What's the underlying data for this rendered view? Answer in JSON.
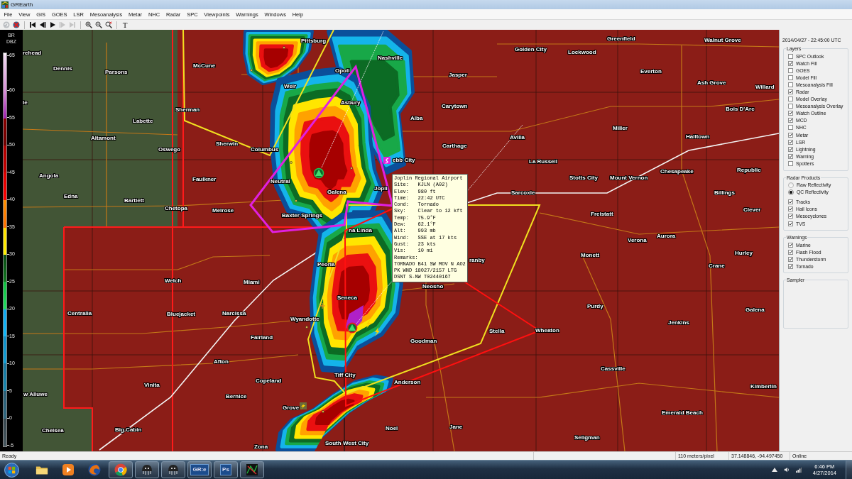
{
  "window": {
    "title": "GREarth"
  },
  "menu": [
    "File",
    "View",
    "GIS",
    "GOES",
    "LSR",
    "Mesoanalysis",
    "Metar",
    "NHC",
    "Radar",
    "SPC",
    "Viewpoints",
    "Warnings",
    "Windows",
    "Help"
  ],
  "toolbar": [
    {
      "kind": "refresh",
      "disabled": true
    },
    {
      "kind": "stop",
      "disabled": false
    },
    {
      "kind": "first",
      "disabled": false
    },
    {
      "kind": "back",
      "disabled": false
    },
    {
      "kind": "play",
      "disabled": false
    },
    {
      "kind": "forward",
      "disabled": true
    },
    {
      "kind": "last",
      "disabled": true
    },
    {
      "kind": "zoom_in",
      "disabled": false
    },
    {
      "kind": "zoom_out",
      "disabled": false
    },
    {
      "kind": "zoom_reset",
      "disabled": false
    },
    {
      "kind": "text",
      "label": "T",
      "disabled": false
    }
  ],
  "color_scale": {
    "title": [
      "BR",
      "DBZ"
    ],
    "ticks": [
      "65",
      "60",
      "55",
      "50",
      "45",
      "40",
      "35",
      "30",
      "25",
      "20",
      "15",
      "10",
      "5",
      "0",
      "-5"
    ]
  },
  "map": {
    "towns": [
      "Pittsburg",
      "Greenfield",
      "Walnut Grove",
      "rehead",
      "Nashville",
      "Golden City",
      "Lockwood",
      "Dennis",
      "Parsons",
      "McCune",
      "Opoli",
      "Jasper",
      "Everton",
      "Weir",
      "Ash Grove",
      "Willard",
      "le",
      "Sherman",
      "Asbury",
      "Carytown",
      "Bois D'Arc",
      "Labette",
      "Alba",
      "Miller",
      "Altamont",
      "Avilla",
      "Halltown",
      "Oswego",
      "Sherwin",
      "Columbus",
      "Carthage",
      "ebb City",
      "La Russell",
      "Angola",
      "Chesapeake",
      "Republic",
      "Faulkner",
      "Neutral",
      "Stotts City",
      "Mount Vernon",
      "Edna",
      "Galena",
      "Jopli",
      "Sarcoxie",
      "Billings",
      "Bartlett",
      "Chetopa",
      "Melrose",
      "Baxter Springs",
      "Freistatt",
      "Clever",
      "na Linda",
      "Verona",
      "Aurora",
      "Peoria",
      "ranby",
      "Monett",
      "Crane",
      "Hurley",
      "Welch",
      "Miami",
      "Neosho",
      "Seneca",
      "Centralia",
      "Bluejacket",
      "Narcissa",
      "Purdy",
      "Galena",
      "Wyandotte",
      "Jenkins",
      "Fairland",
      "Goodman",
      "Stella",
      "Wheaton",
      "Afton",
      "Vinita",
      "Copeland",
      "Tiff City",
      "Anderson",
      "Cassville",
      "Kimberlin",
      "w Alluwe",
      "Bernice",
      "Grove",
      "Emerald Beach",
      "Chelsea",
      "Big Cabin",
      "Noel",
      "Jane",
      "Seligman",
      "Zona",
      "South West City"
    ],
    "tooltip": {
      "title": "Joplin Regional Airport",
      "fields": [
        {
          "label": "Site:",
          "value": "KJLN (A02)"
        },
        {
          "label": "Elev:",
          "value": "980 ft"
        },
        {
          "label": "Time:",
          "value": "22:42 UTC"
        },
        {
          "label": "Cond:",
          "value": "Tornado"
        },
        {
          "label": "Sky:",
          "value": "Clear to 12 kft"
        },
        {
          "label": "Temp:",
          "value": "75.9°F"
        },
        {
          "label": "Dew:",
          "value": "62.1°F"
        },
        {
          "label": "Alt:",
          "value": "993 mb"
        },
        {
          "label": "Wind:",
          "value": "SSE at 17 kts"
        },
        {
          "label": "Gust:",
          "value": "23 kts"
        },
        {
          "label": "Vis:",
          "value": "10 mi"
        }
      ],
      "remarks_label": "Remarks:",
      "remarks": [
        "TORNADO B41 SW MOV N AO2",
        "PK WND 18027/2157 LTG",
        "DSNT S-NW T02440167"
      ]
    }
  },
  "side_panel": {
    "timestamp": "2014/04/27 - 22:45:00 UTC",
    "groups": [
      {
        "title": "Layers",
        "items": [
          {
            "kind": "checkbox",
            "label": "SPC Outlook",
            "checked": false
          },
          {
            "kind": "checkbox",
            "label": "Watch Fill",
            "checked": true
          },
          {
            "kind": "checkbox",
            "label": "GOES",
            "checked": false
          },
          {
            "kind": "checkbox",
            "label": "Model Fill",
            "checked": false
          },
          {
            "kind": "checkbox",
            "label": "Mesoanalysis Fill",
            "checked": false
          },
          {
            "kind": "checkbox",
            "label": "Radar",
            "checked": true
          },
          {
            "kind": "checkbox",
            "label": "Model Overlay",
            "checked": false
          },
          {
            "kind": "checkbox",
            "label": "Mesoanalysis Overlay",
            "checked": false
          },
          {
            "kind": "checkbox",
            "label": "Watch Outline",
            "checked": true
          },
          {
            "kind": "checkbox",
            "label": "MCD",
            "checked": true
          },
          {
            "kind": "checkbox",
            "label": "NHC",
            "checked": false
          },
          {
            "kind": "checkbox",
            "label": "Metar",
            "checked": true
          },
          {
            "kind": "checkbox",
            "label": "LSR",
            "checked": true
          },
          {
            "kind": "checkbox",
            "label": "Lightning",
            "checked": true
          },
          {
            "kind": "checkbox",
            "label": "Warning",
            "checked": true
          },
          {
            "kind": "checkbox",
            "label": "Spotters",
            "checked": false
          }
        ]
      },
      {
        "title": "Radar Products",
        "items": [
          {
            "kind": "radio",
            "label": "Raw Reflectivity",
            "selected": false
          },
          {
            "kind": "radio",
            "label": "QC Reflectivity",
            "selected": true
          },
          {
            "kind": "checkbox",
            "label": "Tracks",
            "checked": true
          },
          {
            "kind": "checkbox",
            "label": "Hail Icons",
            "checked": true
          },
          {
            "kind": "checkbox",
            "label": "Mesocyclones",
            "checked": true
          },
          {
            "kind": "checkbox",
            "label": "TVS",
            "checked": true
          }
        ]
      },
      {
        "title": "Warnings",
        "items": [
          {
            "kind": "checkbox",
            "label": "Marine",
            "checked": true
          },
          {
            "kind": "checkbox",
            "label": "Flash Flood",
            "checked": true
          },
          {
            "kind": "checkbox",
            "label": "Thunderstorm",
            "checked": true
          },
          {
            "kind": "checkbox",
            "label": "Tornado",
            "checked": true
          }
        ]
      },
      {
        "title": "Sampler"
      }
    ]
  },
  "status_bar": {
    "message": "Ready",
    "scale": "110 meters/pixel",
    "coordinates": "37.148846, -94.497450",
    "connection": "Online"
  },
  "taskbar": {
    "apps": [
      {
        "kind": "folder",
        "open": false
      },
      {
        "kind": "media",
        "open": false
      },
      {
        "kind": "globe",
        "open": false
      },
      {
        "kind": "ring",
        "open": true
      },
      {
        "kind": "dome",
        "open": true
      },
      {
        "kind": "dome",
        "open": true
      },
      {
        "kind": "tile",
        "label": "GR:e",
        "open": true
      },
      {
        "kind": "tile",
        "label": "Ps",
        "open": true
      },
      {
        "kind": "map",
        "open": true
      }
    ],
    "clock": {
      "time": "6:46 PM",
      "date": "4/27/2014"
    }
  }
}
